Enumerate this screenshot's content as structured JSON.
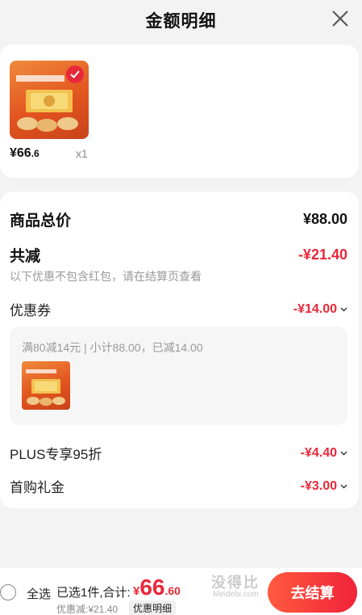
{
  "header": {
    "title": "金额明细",
    "close_icon": "close-icon"
  },
  "product": {
    "price_int": "¥66",
    "price_frac": ".6",
    "qty": "x1",
    "colors": {
      "thumb": "#e2541f",
      "check": "#e8283a"
    }
  },
  "summary": {
    "total_label": "商品总价",
    "total_value": "¥88.00",
    "reduce_label": "共减",
    "reduce_value": "-¥21.40",
    "note": "以下优惠不包含红包，请在结算页查看",
    "coupon_label": "优惠券",
    "coupon_value": "-¥14.00",
    "coupon_desc": "满80减14元 | 小计88.00，已减14.00",
    "plus_label": "PLUS专享95折",
    "plus_value": "-¥4.40",
    "first_label": "首购礼金",
    "first_value": "-¥3.00"
  },
  "bottom": {
    "select_all": "全选",
    "chosen": "已选1件,合计:",
    "total_cur": "¥",
    "total_int": "66",
    "total_frac": ".60",
    "discount": "优惠减:¥21.40",
    "detail": "优惠明细",
    "checkout": "去结算"
  },
  "watermark": {
    "text": "没得比",
    "sub": "Meidebi.com"
  },
  "accent": "#e8283a"
}
